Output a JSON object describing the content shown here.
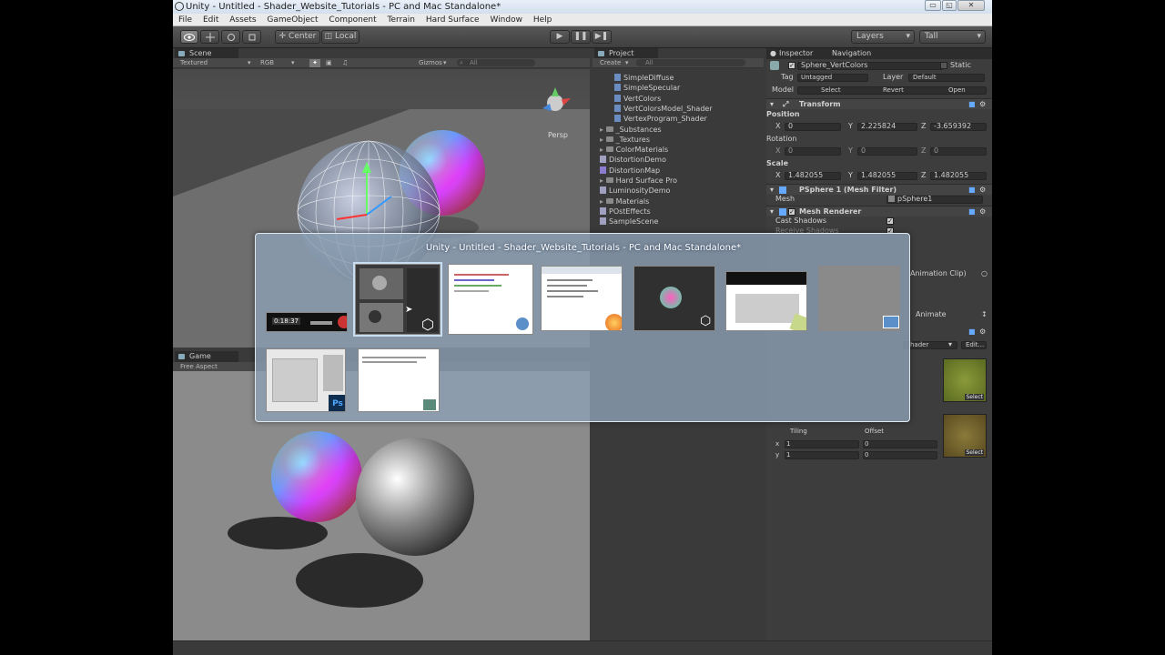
{
  "window": {
    "title": "Unity - Untitled - Shader_Website_Tutorials - PC and Mac Standalone*",
    "controls": [
      "▭",
      "◱",
      "✕"
    ]
  },
  "menu": [
    "File",
    "Edit",
    "Assets",
    "GameObject",
    "Component",
    "Terrain",
    "Hard Surface",
    "Window",
    "Help"
  ],
  "toolbar": {
    "pivot": "Center",
    "space": "Local",
    "layers": "Layers",
    "layout": "Tall"
  },
  "scene": {
    "tab": "Scene",
    "shading": "Textured",
    "render_mode": "RGB",
    "gizmos": "Gizmos",
    "search": "All",
    "projection": "Persp"
  },
  "game": {
    "tab": "Game",
    "aspect": "Free Aspect"
  },
  "project": {
    "tab": "Project",
    "create": "Create",
    "search": "All",
    "items": [
      {
        "label": "SimpleDiffuse",
        "kind": "file",
        "indent": 2
      },
      {
        "label": "SimpleSpecular",
        "kind": "file",
        "indent": 2
      },
      {
        "label": "VertColors",
        "kind": "file",
        "indent": 2
      },
      {
        "label": "VertColorsModel_Shader",
        "kind": "file",
        "indent": 2
      },
      {
        "label": "VertexProgram_Shader",
        "kind": "file",
        "indent": 2
      },
      {
        "label": "_Substances",
        "kind": "folder",
        "indent": 1
      },
      {
        "label": "_Textures",
        "kind": "folder",
        "indent": 1
      },
      {
        "label": "ColorMaterials",
        "kind": "folder",
        "indent": 1
      },
      {
        "label": "DistortionDemo",
        "kind": "scene",
        "indent": 1
      },
      {
        "label": "DistortionMap",
        "kind": "image",
        "indent": 1
      },
      {
        "label": "Hard Surface Pro",
        "kind": "folder",
        "indent": 1
      },
      {
        "label": "LuminosityDemo",
        "kind": "scene",
        "indent": 1
      },
      {
        "label": "Materials",
        "kind": "folder",
        "indent": 1
      },
      {
        "label": "POstEffects",
        "kind": "scene",
        "indent": 1
      },
      {
        "label": "SampleScene",
        "kind": "scene",
        "indent": 1
      }
    ]
  },
  "inspector": {
    "tab": "Inspector",
    "tab2": "Navigation",
    "object_name": "Sphere_VertColors",
    "static": "Static",
    "tag_label": "Tag",
    "tag": "Untagged",
    "layer_label": "Layer",
    "layer": "Default",
    "model_label": "Model",
    "model_select": "Select",
    "model_revert": "Revert",
    "model_open": "Open",
    "transform": {
      "title": "Transform",
      "position_label": "Position",
      "position": {
        "x": "0",
        "y": "2.225824",
        "z": "-3.659392"
      },
      "rotation_label": "Rotation",
      "rotation": {
        "x": "0",
        "y": "0",
        "z": "0"
      },
      "scale_label": "Scale",
      "scale": {
        "x": "1.482055",
        "y": "1.482055",
        "z": "1.482055"
      }
    },
    "mesh_filter": {
      "title": "PSphere 1 (Mesh Filter)",
      "mesh_label": "Mesh",
      "mesh": "pSphere1"
    },
    "mesh_renderer": {
      "title": "Mesh Renderer",
      "cast_shadows": "Cast Shadows",
      "receive_shadows": "Receive Shadows"
    },
    "animation_clip": "Animation Clip)",
    "animate": "Animate",
    "shader_suffix": "hader",
    "edit": "Edit...",
    "tiling": "Tiling",
    "offset": "Offset",
    "tile_x": "1",
    "tile_y": "1",
    "off_x": "0",
    "off_y": "0",
    "select": "Select"
  },
  "switcher": {
    "title": "Unity - Untitled - Shader_Website_Tutorials - PC and Mac Standalone*",
    "timer": "0:18:37",
    "colors": {
      "accent": "#5b8fc9",
      "firefox": "#e8641b"
    }
  }
}
